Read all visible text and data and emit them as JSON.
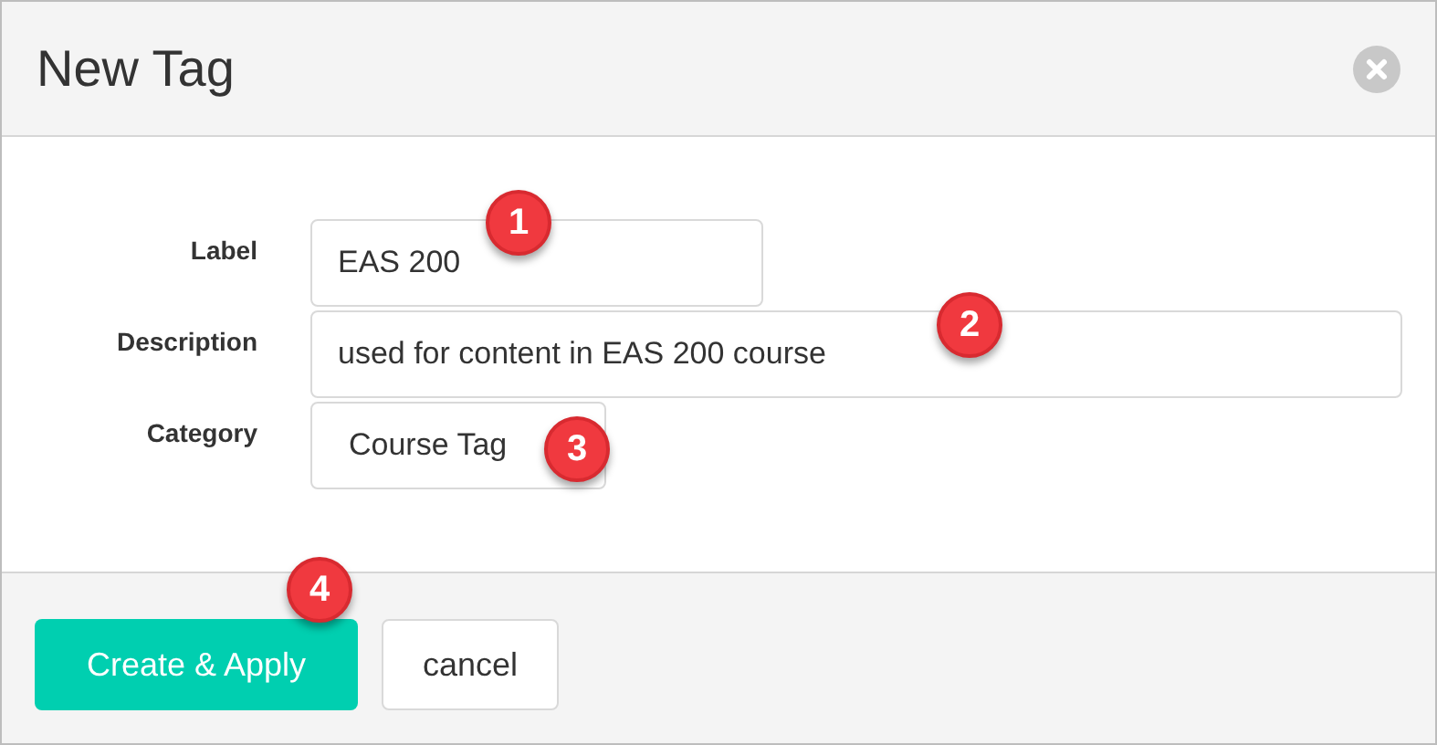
{
  "dialog": {
    "title": "New Tag"
  },
  "fields": [
    {
      "label": "Label",
      "value": "EAS 200",
      "kind": "short",
      "callout": "1"
    },
    {
      "label": "Description",
      "value": "used for content in EAS 200 course",
      "kind": "wide",
      "callout": "2"
    },
    {
      "label": "Category",
      "value": "Course Tag",
      "kind": "select",
      "callout": "3"
    }
  ],
  "buttons": [
    {
      "label": "Create & Apply",
      "kind": "primary",
      "callout": "4"
    },
    {
      "label": "cancel",
      "kind": "secondary"
    }
  ]
}
